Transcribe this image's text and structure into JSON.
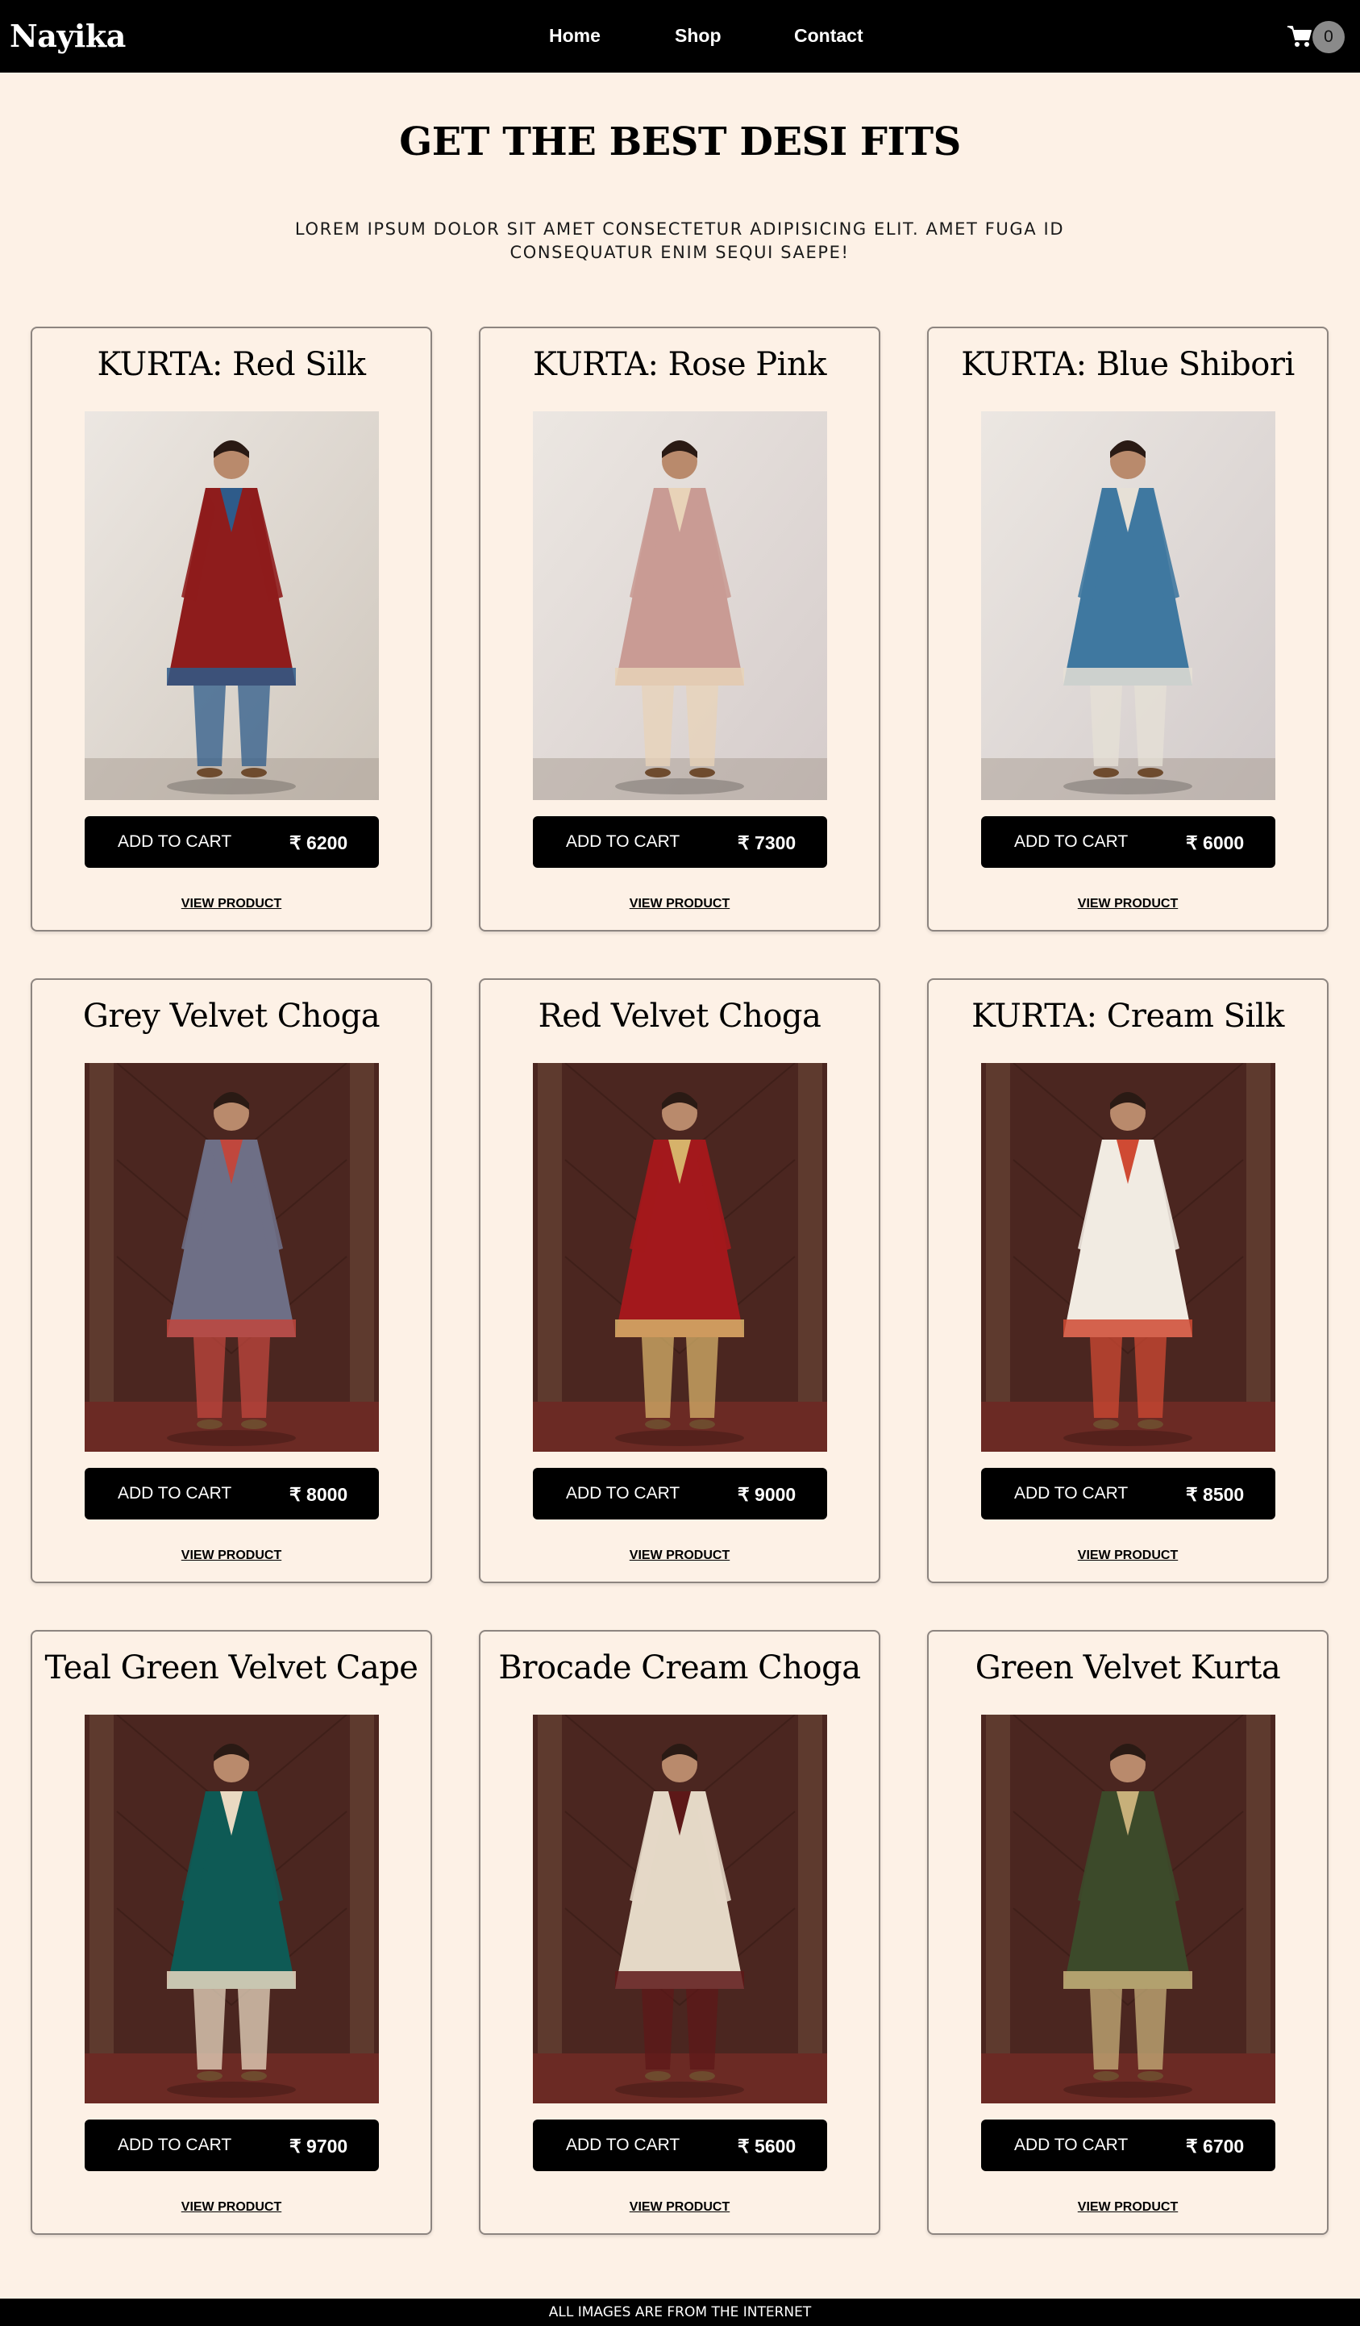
{
  "nav": {
    "brand": "Nayika",
    "links": [
      "Home",
      "Shop",
      "Contact"
    ],
    "cart_count": "0",
    "cart_icon": "shopping-cart-icon"
  },
  "header": {
    "title": "GET THE BEST DESI FITS",
    "subtitle": "LOREM IPSUM DOLOR SIT AMET CONSECTETUR ADIPISICING ELIT. AMET FUGA ID CONSEQUATUR ENIM SEQUI SAEPE!"
  },
  "products": [
    {
      "name": "KURTA: Red Silk",
      "cart_label": "ADD TO CART",
      "price": "₹ 6200",
      "view_label": "VIEW PRODUCT",
      "bg": "#cfc7bd",
      "garment": "#8e1c1c",
      "accent": "#2e5b8a"
    },
    {
      "name": "KURTA: Rose Pink",
      "cart_label": "ADD TO CART",
      "price": "₹ 7300",
      "view_label": "VIEW PRODUCT",
      "bg": "#d5cccb",
      "garment": "#c99b94",
      "accent": "#e8d3b8"
    },
    {
      "name": "KURTA: Blue Shibori",
      "cart_label": "ADD TO CART",
      "price": "₹ 6000",
      "view_label": "VIEW PRODUCT",
      "bg": "#d2cbcb",
      "garment": "#3f78a0",
      "accent": "#e6e0d6"
    },
    {
      "name": "Grey Velvet Choga",
      "cart_label": "ADD TO CART",
      "price": "₹ 8000",
      "view_label": "VIEW PRODUCT",
      "bg": "#4b2620",
      "garment": "#6e6f86",
      "accent": "#c0473d"
    },
    {
      "name": "Red Velvet Choga",
      "cart_label": "ADD TO CART",
      "price": "₹ 9000",
      "view_label": "VIEW PRODUCT",
      "bg": "#4b2620",
      "garment": "#a3181c",
      "accent": "#d6b26a"
    },
    {
      "name": "KURTA: Cream Silk",
      "cart_label": "ADD TO CART",
      "price": "₹ 8500",
      "view_label": "VIEW PRODUCT",
      "bg": "#4b2620",
      "garment": "#f1ebe2",
      "accent": "#cf4a33"
    },
    {
      "name": "Teal Green Velvet Cape",
      "cart_label": "ADD TO CART",
      "price": "₹ 9700",
      "view_label": "VIEW PRODUCT",
      "bg": "#4b2620",
      "garment": "#0e5a55",
      "accent": "#e9d9c2"
    },
    {
      "name": "Brocade Cream Choga",
      "cart_label": "ADD TO CART",
      "price": "₹ 5600",
      "view_label": "VIEW PRODUCT",
      "bg": "#4b2620",
      "garment": "#e4d8c6",
      "accent": "#5d1818"
    },
    {
      "name": "Green Velvet Kurta",
      "cart_label": "ADD TO CART",
      "price": "₹ 6700",
      "view_label": "VIEW PRODUCT",
      "bg": "#4b2620",
      "garment": "#3c4a2a",
      "accent": "#c7b07a"
    }
  ],
  "footer": {
    "text": "ALL IMAGES ARE FROM THE INTERNET"
  }
}
